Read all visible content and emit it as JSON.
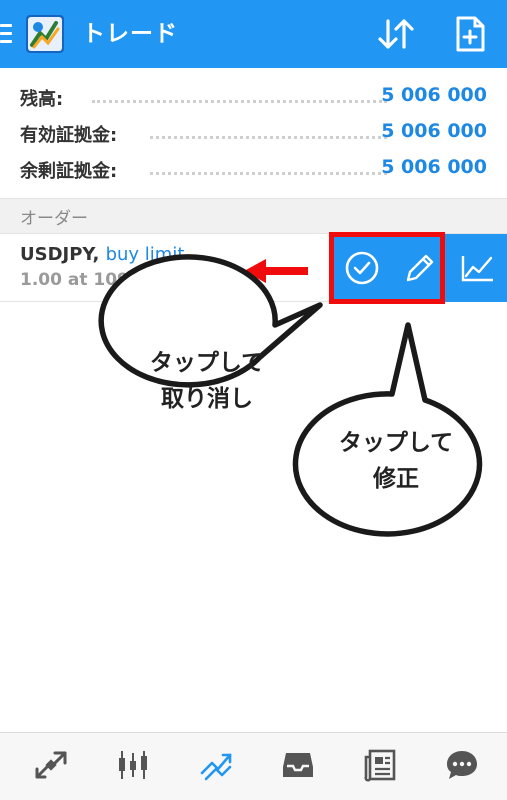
{
  "header": {
    "title": "トレード",
    "menu_icon": "menu-icon",
    "logo_icon": "metatrader-logo-icon",
    "sort_icon": "sort-icon",
    "new_order_icon": "new-order-icon"
  },
  "summary": {
    "rows": [
      {
        "label": "残高:",
        "value": "5 006 000"
      },
      {
        "label": "有効証拠金:",
        "value": "5 006 000"
      },
      {
        "label": "余剰証拠金:",
        "value": "5 006 000"
      }
    ]
  },
  "orders": {
    "section_title": "オーダー",
    "items": [
      {
        "symbol": "USDJPY,",
        "type": "buy limit",
        "details": "1.00 at 109.700"
      }
    ],
    "actions": {
      "confirm_icon": "check-circle-icon",
      "edit_icon": "pencil-icon",
      "chart_icon": "chart-line-icon"
    }
  },
  "callouts": {
    "cancel": {
      "line1": "タップして",
      "line2": "取り消し"
    },
    "edit": {
      "line1": "タップして",
      "line2": "修正"
    }
  },
  "bottom_nav": {
    "items": [
      {
        "icon": "quotes-icon",
        "active": false
      },
      {
        "icon": "candlestick-chart-icon",
        "active": false
      },
      {
        "icon": "trade-icon",
        "active": true
      },
      {
        "icon": "history-inbox-icon",
        "active": false
      },
      {
        "icon": "news-icon",
        "active": false
      },
      {
        "icon": "chat-icon",
        "active": false
      }
    ]
  },
  "colors": {
    "primary": "#2196f3",
    "value_blue": "#1e88e5",
    "highlight_red": "#f00c0c",
    "active_nav": "#2196f3",
    "inactive_nav": "#555555"
  }
}
